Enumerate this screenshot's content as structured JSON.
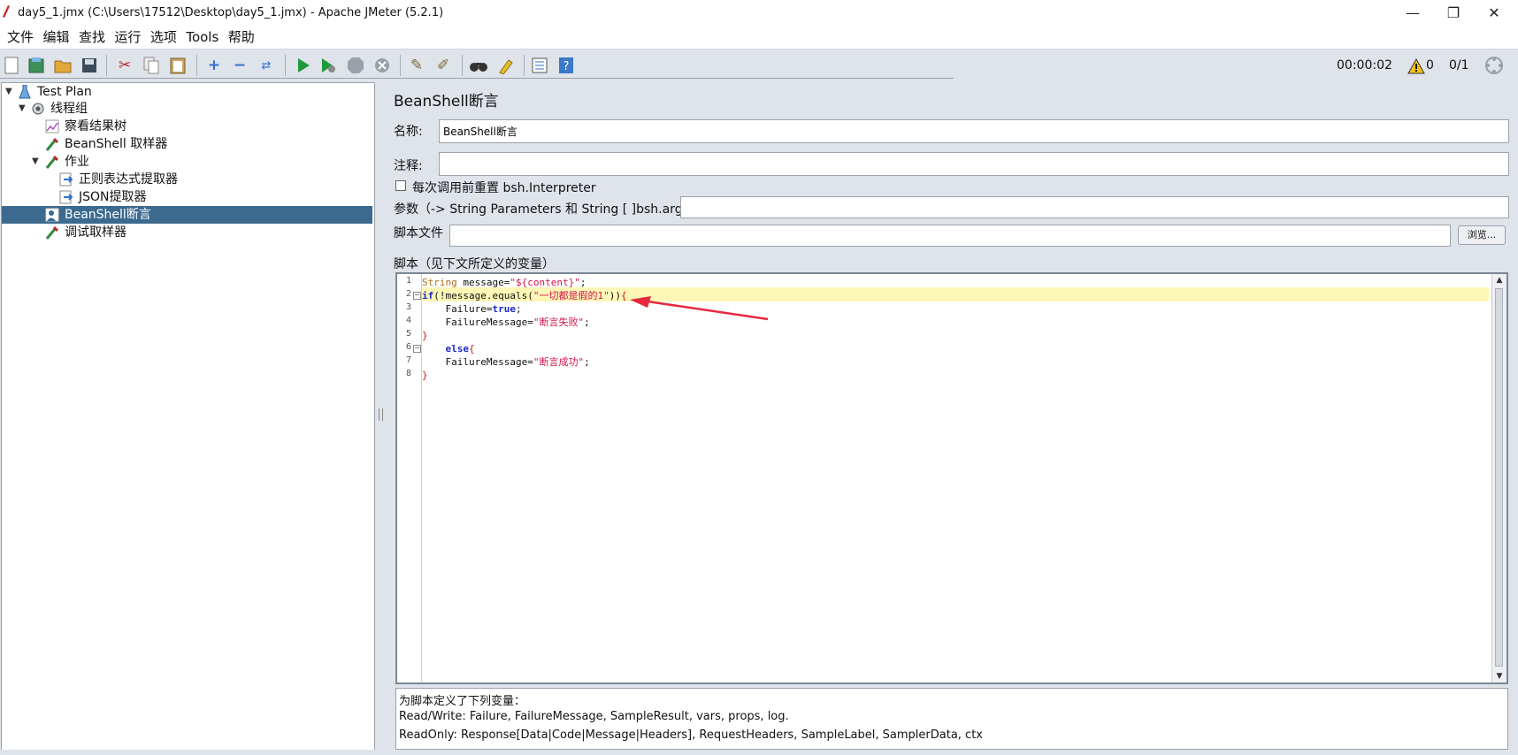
{
  "window": {
    "title": "day5_1.jmx (C:\\Users\\17512\\Desktop\\day5_1.jmx) - Apache JMeter (5.2.1)",
    "minimize": "—",
    "restore": "❐",
    "close": "✕"
  },
  "menu": [
    "文件",
    "编辑",
    "查找",
    "运行",
    "选项",
    "Tools",
    "帮助"
  ],
  "toolbar": {
    "icons": [
      "new-icon",
      "templates-icon",
      "open-icon",
      "save-icon",
      "cut-icon",
      "copy-icon",
      "paste-icon",
      "expand-icon",
      "collapse-icon",
      "toggle-icon",
      "start-icon",
      "start-no-pause-icon",
      "stop-icon",
      "shutdown-icon",
      "clear-icon",
      "clear-all-icon",
      "search-icon",
      "reset-search-icon",
      "function-helper-icon",
      "help-icon"
    ],
    "timer": "00:00:02",
    "warnings": "0",
    "threads": "0/1"
  },
  "tree": [
    {
      "label": "Test Plan",
      "icon": "test-plan-icon"
    },
    {
      "label": "线程组",
      "icon": "thread-group-icon"
    },
    {
      "label": "察看结果树",
      "icon": "results-tree-icon"
    },
    {
      "label": "BeanShell 取样器",
      "icon": "sampler-icon"
    },
    {
      "label": "作业",
      "icon": "sampler-icon"
    },
    {
      "label": "正则表达式提取器",
      "icon": "extractor-icon"
    },
    {
      "label": "JSON提取器",
      "icon": "extractor-icon"
    },
    {
      "label": "BeanShell断言",
      "icon": "assertion-icon",
      "selected": true
    },
    {
      "label": "调试取样器",
      "icon": "sampler-icon"
    }
  ],
  "panel": {
    "title": "BeanShell断言",
    "name_label": "名称:",
    "name_value": "BeanShell断言",
    "comment_label": "注释:",
    "comment_value": "",
    "reset_label": "每次调用前重置 bsh.Interpreter",
    "params_label": "参数（-> String Parameters 和 String [ ]bsh.args）",
    "params_value": "",
    "script_file_label": "脚本文件",
    "script_file_value": "",
    "browse_label": "浏览...",
    "script_label": "脚本（见下文所定义的变量）"
  },
  "script": {
    "line_numbers": [
      "1",
      "2",
      "3",
      "4",
      "5",
      "6",
      "7",
      "8"
    ],
    "lines": [
      "String message=\"${content}\";",
      "if(!message.equals(\"一切都是假的1\")){",
      "    Failure=true;",
      "    FailureMessage=\"断言失败\";",
      "}",
      "    else{",
      "    FailureMessage=\"断言成功\";",
      "}"
    ]
  },
  "variables": {
    "heading": "为脚本定义了下列变量：",
    "read_write": "Read/Write: Failure, FailureMessage, SampleResult, vars, props, log.",
    "read_only": "ReadOnly: Response[Data|Code|Message|Headers], RequestHeaders, SampleLabel, SamplerData, ctx"
  },
  "colors": {
    "selection": "#3c6a8f",
    "highlight_line": "#fdf7b7",
    "keyword": "#1e29c8",
    "string": "#d2144b",
    "annotation_arrow": "#e8283c"
  }
}
